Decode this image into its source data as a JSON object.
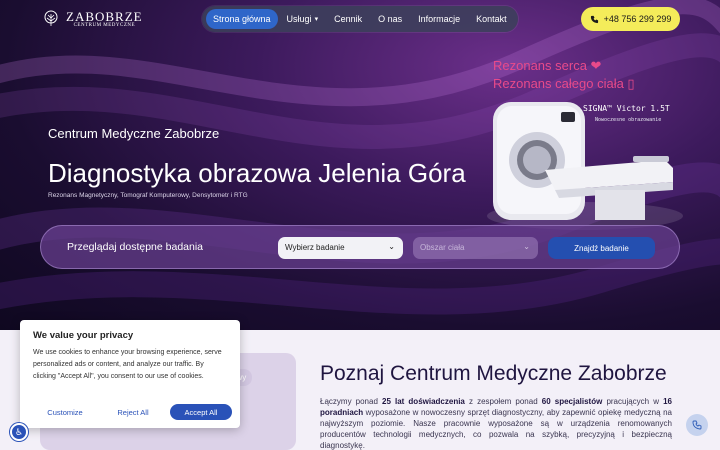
{
  "brand": {
    "name": "ZABOBRZE",
    "tagline": "CENTRUM MEDYCZNE"
  },
  "nav": {
    "items": [
      {
        "label": "Strona główna",
        "active": true
      },
      {
        "label": "Usługi",
        "dropdown": true
      },
      {
        "label": "Cennik"
      },
      {
        "label": "O nas"
      },
      {
        "label": "Informacje"
      },
      {
        "label": "Kontakt"
      }
    ]
  },
  "phone": {
    "label": "+48 756 299 299"
  },
  "hero": {
    "rez1": "Rezonans serca ❤",
    "rez2": "Rezonans całego ciała ▯",
    "machine_name": "SIGNA™ Victor 1.5T",
    "machine_sub": "Nowoczesne obrazowanie",
    "subtitle": "Centrum Medyczne Zabobrze",
    "title": "Diagnostyka obrazowa Jelenia Góra",
    "desc": "Rezonans Magnetyczny, Tomograf Komputerowy, Densytometr i RTG"
  },
  "search": {
    "label": "Przeglądaj dostępne badania",
    "select_exam": "Wybierz badanie",
    "select_area": "Obszar ciała",
    "button": "Znajdź badanie"
  },
  "about": {
    "title": "Poznaj Centrum Medyczne Zabobrze",
    "p1": "Łączymy ponad ",
    "b1": "25 lat doświadczenia",
    "p2": " z zespołem ponad ",
    "b2": "60 specjalistów",
    "p3": " pracujących w ",
    "b3": "16 poradniach",
    "p4": " wyposażone w nowoczesny sprzęt diagnostyczny, aby zapewnić opiekę medyczną na najwyższym poziomie. Nasze pracownie wyposażone są w urządzenia renomowanych producentów technologii medycznych, co pozwala na szybką, precyzyjną i bezpieczną diagnostykę.",
    "image_pill": "owy"
  },
  "cookie": {
    "title": "We value your privacy",
    "text": "We use cookies to enhance your browsing experience, serve personalized ads or content, and analyze our traffic. By clicking \"Accept All\", you consent to our use of cookies.",
    "customize": "Customize",
    "reject": "Reject All",
    "accept": "Accept All"
  },
  "colors": {
    "accent": "#2f66c9",
    "phone_bg": "#f4ec5a",
    "rezonans": "#e84a8a",
    "hero_bg": "#3c1a5c"
  },
  "icons": {
    "phone": "phone-icon",
    "accessibility": "accessibility-icon",
    "call_float": "phone-icon"
  }
}
